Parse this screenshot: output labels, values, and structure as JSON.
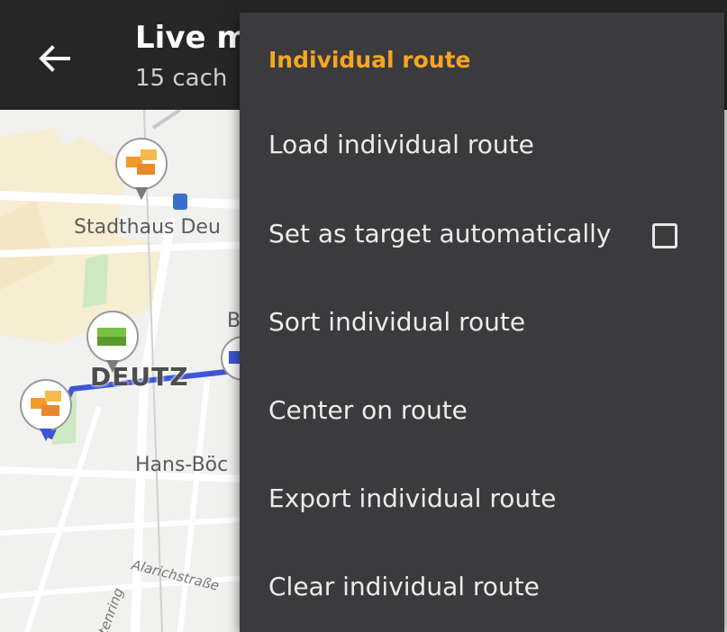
{
  "header": {
    "title": "Live m",
    "subtitle": "15 cach"
  },
  "map": {
    "labels": {
      "stadthaus": "Stadthaus Deu",
      "district": "DEUTZ",
      "hans": "Hans-Böc",
      "b": "B",
      "street1": "Alarichstraße",
      "street2": "tenring"
    },
    "route_color": "#3d55d6"
  },
  "menu": {
    "header": "Individual route",
    "header_color": "#f5a623",
    "items": [
      {
        "label": "Load individual route"
      },
      {
        "label": "Set as target automatically",
        "checkbox": false
      },
      {
        "label": "Sort individual route"
      },
      {
        "label": "Center on route"
      },
      {
        "label": "Export individual route"
      },
      {
        "label": "Clear individual route"
      }
    ]
  }
}
